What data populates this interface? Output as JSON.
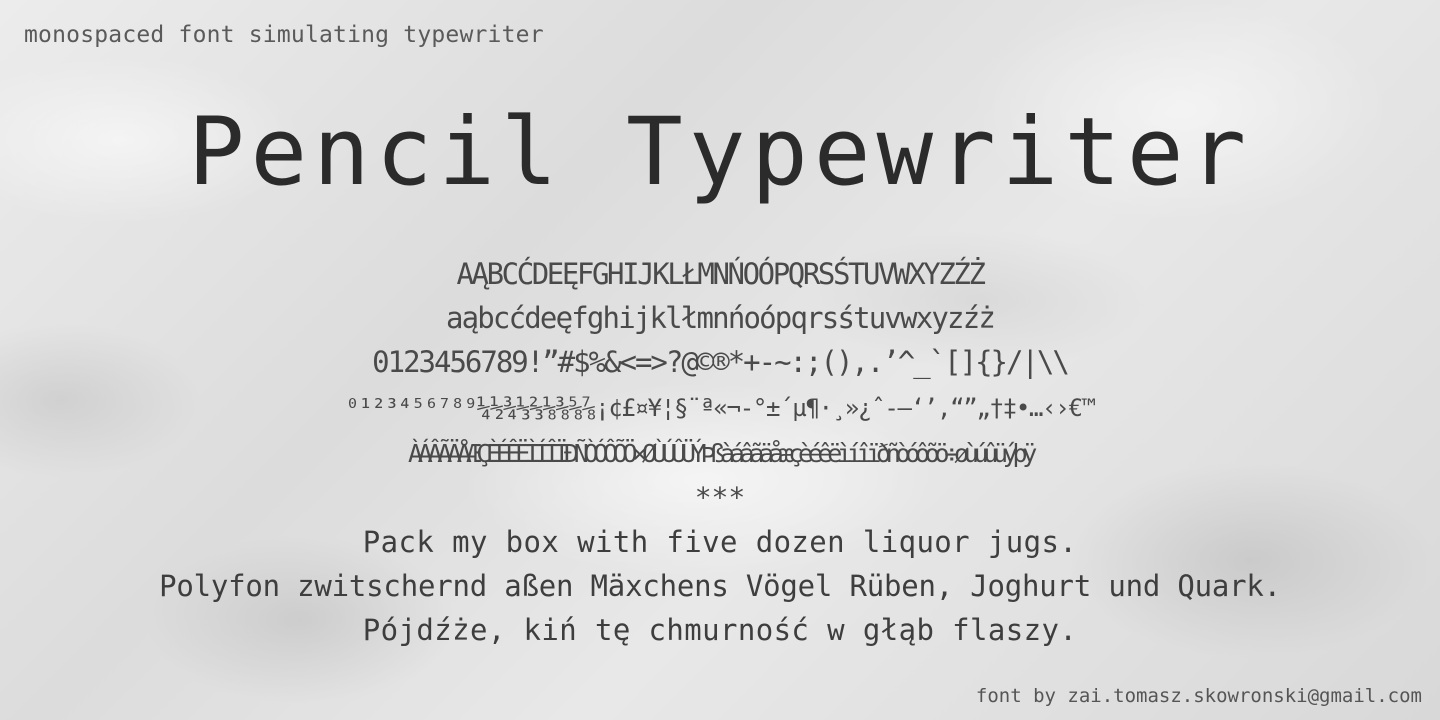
{
  "subtitle": "monospaced font simulating typewriter",
  "title": "Pencil Typewriter",
  "specimen": {
    "uppercase": "AĄBCĆDEĘFGHIJKLŁMNŃOÓPQRSŚTUVWXYZŹŻ",
    "lowercase": "aąbcćdeęfghijklłmnńoópqrsśtuvwxyzźż",
    "digits_punct": "0123456789!”#$%&<=>?@©®*+-~:;(),.’^_`[]{}/|\\\\",
    "symbols": "⁰¹²³⁴⁵⁶⁷⁸⁹¼½¾⅓⅔⅛⅜⅝⅞¡¢£¤¥¦§¨ª«¬-°±´µ¶·¸»¿ˆ-–‘’‚“”„†‡•…‹›€™",
    "accented": "ÀÁÂÃÄÅÆÇÈÉÊËÌÍÎÏÐÑÒÓÔÕÖ×ØÙÚÛÜÝÞßàáâãäåæçèéêëìíîïðñòóôõö÷øùúûüýþÿ",
    "separator": "***"
  },
  "pangrams": {
    "english": "Pack my box with five dozen liquor jugs.",
    "german": "Polyfon zwitschernd aßen Mäxchens Vögel Rüben, Joghurt und Quark.",
    "polish": "Pójdźże, kiń tę chmurność w głąb flaszy."
  },
  "credit": "font by zai.tomasz.skowronski@gmail.com"
}
